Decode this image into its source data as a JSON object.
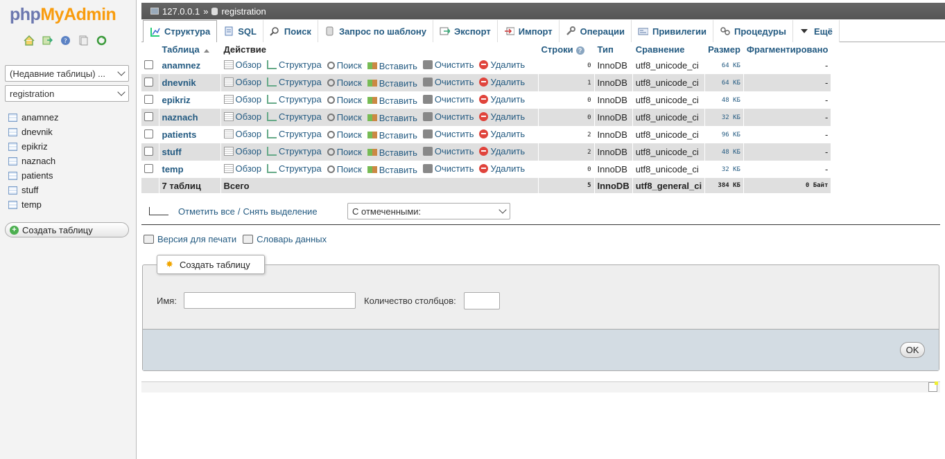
{
  "nav": {
    "logo_php": "php",
    "logo_myadmin": "MyAdmin",
    "icons": [
      "home-icon",
      "logout-icon",
      "help-icon",
      "docs-icon",
      "reload-icon"
    ],
    "recent_tables": "(Недавние таблицы) ...",
    "database_select": "registration",
    "tables": [
      "anamnez",
      "dnevnik",
      "epikriz",
      "naznach",
      "patients",
      "stuff",
      "temp"
    ],
    "create_table": "Создать таблицу"
  },
  "breadcrumb": {
    "server": "127.0.0.1",
    "separator": "»",
    "database": "registration"
  },
  "tabs": [
    {
      "label": "Структура",
      "icon": "structure-icon"
    },
    {
      "label": "SQL",
      "icon": "sql-icon"
    },
    {
      "label": "Поиск",
      "icon": "search-icon"
    },
    {
      "label": "Запрос по шаблону",
      "icon": "query-icon"
    },
    {
      "label": "Экспорт",
      "icon": "export-icon"
    },
    {
      "label": "Импорт",
      "icon": "import-icon"
    },
    {
      "label": "Операции",
      "icon": "wrench-icon"
    },
    {
      "label": "Привилегии",
      "icon": "privileges-icon"
    },
    {
      "label": "Процедуры",
      "icon": "routines-icon"
    },
    {
      "label": "Ещё",
      "icon": "chevron-down-icon"
    }
  ],
  "table": {
    "headers": {
      "table": "Таблица",
      "action": "Действие",
      "rows": "Строки",
      "type": "Тип",
      "collation": "Сравнение",
      "size": "Размер",
      "overhead": "Фрагментировано"
    },
    "actions": {
      "browse": "Обзор",
      "structure": "Структура",
      "search": "Поиск",
      "insert": "Вставить",
      "empty": "Очистить",
      "drop": "Удалить"
    },
    "rows": [
      {
        "name": "anamnez",
        "rows": "0",
        "type": "InnoDB",
        "collation": "utf8_unicode_ci",
        "size": "64 КБ",
        "overhead": "-"
      },
      {
        "name": "dnevnik",
        "rows": "1",
        "type": "InnoDB",
        "collation": "utf8_unicode_ci",
        "size": "64 КБ",
        "overhead": "-"
      },
      {
        "name": "epikriz",
        "rows": "0",
        "type": "InnoDB",
        "collation": "utf8_unicode_ci",
        "size": "48 КБ",
        "overhead": "-"
      },
      {
        "name": "naznach",
        "rows": "0",
        "type": "InnoDB",
        "collation": "utf8_unicode_ci",
        "size": "32 КБ",
        "overhead": "-"
      },
      {
        "name": "patients",
        "rows": "2",
        "type": "InnoDB",
        "collation": "utf8_unicode_ci",
        "size": "96 КБ",
        "overhead": "-"
      },
      {
        "name": "stuff",
        "rows": "2",
        "type": "InnoDB",
        "collation": "utf8_unicode_ci",
        "size": "48 КБ",
        "overhead": "-"
      },
      {
        "name": "temp",
        "rows": "0",
        "type": "InnoDB",
        "collation": "utf8_unicode_ci",
        "size": "32 КБ",
        "overhead": "-"
      }
    ],
    "footer": {
      "count": "7 таблиц",
      "total_label": "Всего",
      "rows": "5",
      "type": "InnoDB",
      "collation": "utf8_general_ci",
      "size": "384 КБ",
      "overhead": "0 Байт"
    }
  },
  "bulk": {
    "check_all": "Отметить все",
    "separator": "/",
    "uncheck_all": "Снять выделение",
    "with_selected": "С отмеченными:"
  },
  "links": {
    "print_view": "Версия для печати",
    "data_dictionary": "Словарь данных"
  },
  "create_table": {
    "legend": "Создать таблицу",
    "name_label": "Имя:",
    "name_value": "",
    "columns_label": "Количество столбцов:",
    "columns_value": "",
    "ok": "OK"
  }
}
